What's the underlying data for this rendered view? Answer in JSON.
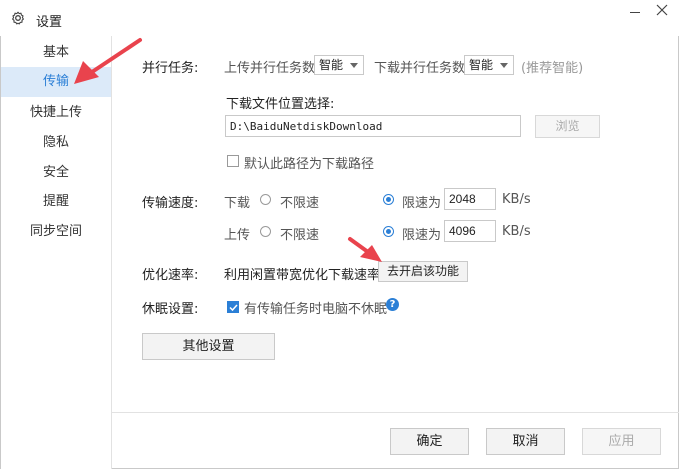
{
  "window": {
    "title": "设置",
    "controls": {
      "minimize": "minimize",
      "close": "close"
    }
  },
  "sidebar": {
    "items": [
      {
        "label": "基本",
        "active": false
      },
      {
        "label": "传输",
        "active": true
      },
      {
        "label": "快捷上传",
        "active": false
      },
      {
        "label": "隐私",
        "active": false
      },
      {
        "label": "安全",
        "active": false
      },
      {
        "label": "提醒",
        "active": false
      },
      {
        "label": "同步空间",
        "active": false
      }
    ]
  },
  "parallel": {
    "label": "并行任务:",
    "upload_label": "上传并行任务数",
    "upload_value": "智能",
    "download_label": "下载并行任务数",
    "download_value": "智能",
    "hint": "(推荐智能)"
  },
  "download_location": {
    "label": "下载文件位置选择:",
    "path": "D:\\BaiduNetdiskDownload",
    "browse_label": "浏览",
    "default_checkbox_label": "默认此路径为下载路径",
    "default_checked": false
  },
  "speed": {
    "label": "传输速度:",
    "download": {
      "label": "下载",
      "unlimited_label": "不限速",
      "limit_label": "限速为",
      "value": "2048",
      "unit": "KB/s",
      "selected": "limit"
    },
    "upload": {
      "label": "上传",
      "unlimited_label": "不限速",
      "limit_label": "限速为",
      "value": "4096",
      "unit": "KB/s",
      "selected": "limit"
    }
  },
  "optimize": {
    "label": "优化速率:",
    "text": "利用闲置带宽优化下载速率",
    "button_label": "去开启该功能"
  },
  "sleep": {
    "label": "休眠设置:",
    "checkbox_label": "有传输任务时电脑不休眠",
    "checked": true,
    "help_icon": "question-circle-icon"
  },
  "other_button_label": "其他设置",
  "footer": {
    "ok_label": "确定",
    "cancel_label": "取消",
    "apply_label": "应用"
  },
  "colors": {
    "accent": "#2b7fd6",
    "active_bg": "#dceaf9",
    "annotation_arrow": "#e9434d"
  }
}
